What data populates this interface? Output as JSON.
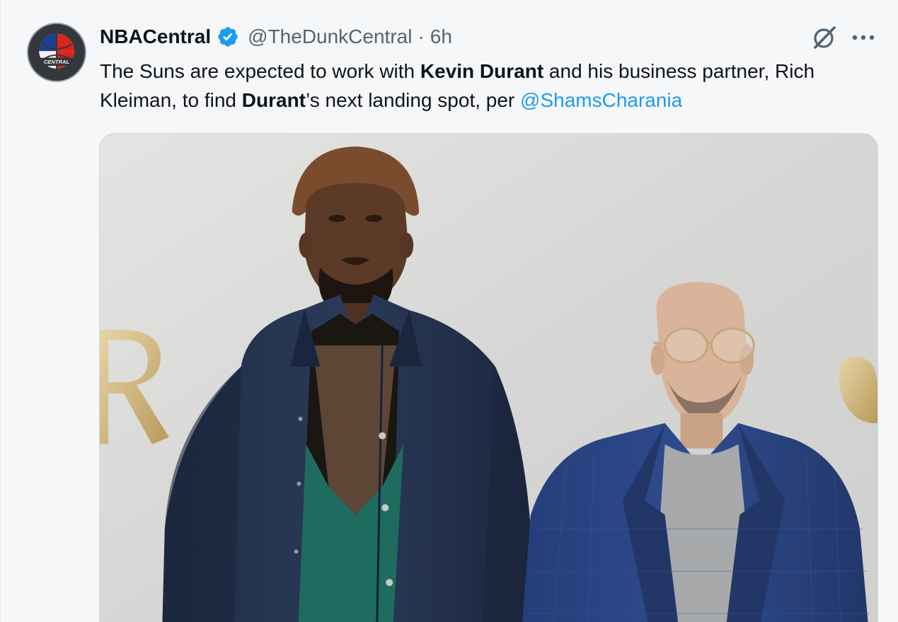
{
  "tweet": {
    "avatar_icon": "nba-central-logo-icon",
    "display_name": "NBACentral",
    "verified_icon": "verified-badge-icon",
    "handle": "@TheDunkCentral",
    "separator": "·",
    "time": "6h",
    "actions": {
      "grok_icon": "grok-icon",
      "more_icon": "more-options-icon"
    },
    "text": {
      "part1": "The Suns are expected to work with ",
      "bold1": "Kevin Durant",
      "part2": " and his business partner, Rich Kleiman, to find ",
      "bold2": "Durant",
      "part3": "’s next landing spot, per ",
      "mention": "@ShamsCharania"
    },
    "media": {
      "type": "photo",
      "subject": "photo"
    }
  },
  "colors": {
    "link": "#1d9bf0",
    "verified": "#1d9bf0",
    "secondary_text": "#536471",
    "primary_text": "#0f1419"
  }
}
